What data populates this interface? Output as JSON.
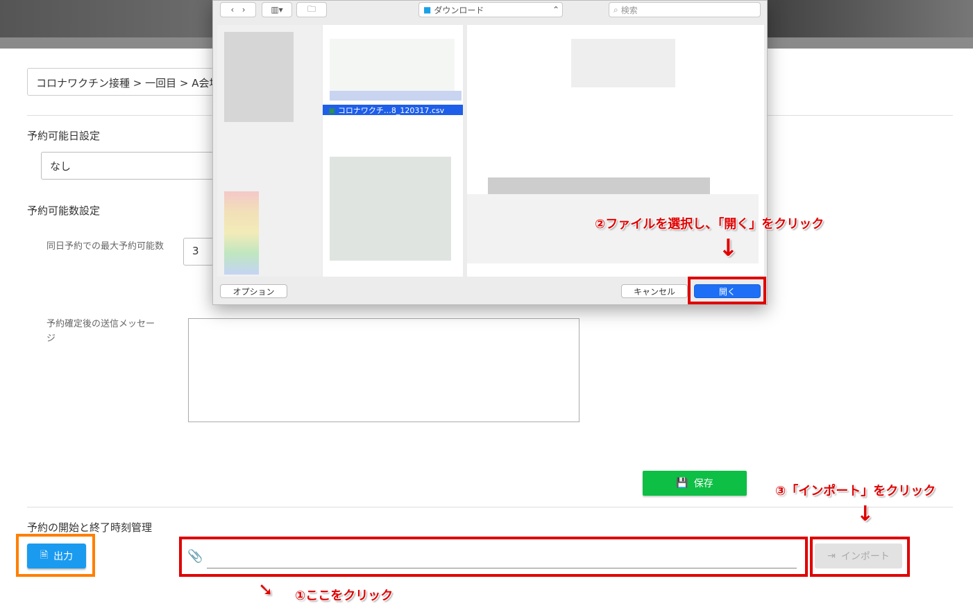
{
  "breadcrumb": "コロナワクチン接種 > 一回目 > A会場",
  "sections": {
    "reservable_date": {
      "title": "予約可能日設定",
      "value": "なし"
    },
    "reservable_count": {
      "title": "予約可能数設定",
      "max_label": "同日予約での最大予約可能数",
      "max_value": "3",
      "message_label": "予約確定後の送信メッセージ",
      "message_value": ""
    },
    "time_management": {
      "title": "予約の開始と終了時刻管理"
    }
  },
  "buttons": {
    "save": "保存",
    "export": "出力",
    "import": "インポート"
  },
  "dialog": {
    "location": "ダウンロード",
    "search_placeholder": "検索",
    "selected_file": "コロナワクチ…8_120317.csv",
    "options": "オプション",
    "cancel": "キャンセル",
    "open": "開く"
  },
  "annotations": {
    "step1": "①ここをクリック",
    "step2": "②ファイルを選択し、「開く」をクリック",
    "step3": "③「インポート」をクリック"
  },
  "colors": {
    "annotation": "#e00000",
    "export_highlight": "#ff7f00",
    "save": "#0dbf45",
    "export": "#1a9bf0",
    "open": "#1e6ff5"
  }
}
